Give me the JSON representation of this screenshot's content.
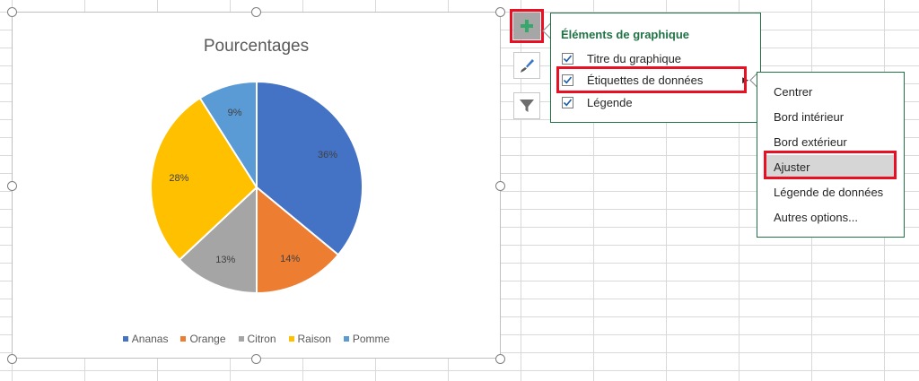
{
  "chart": {
    "title": "Pourcentages",
    "legend": [
      "Ananas",
      "Orange",
      "Citron",
      "Raison",
      "Pomme"
    ]
  },
  "chart_data": {
    "type": "pie",
    "title": "Pourcentages",
    "categories": [
      "Ananas",
      "Orange",
      "Citron",
      "Raison",
      "Pomme"
    ],
    "values": [
      36,
      14,
      13,
      28,
      9
    ],
    "labels": [
      "36%",
      "14%",
      "13%",
      "28%",
      "9%"
    ],
    "colors": [
      "#4472c4",
      "#ed7d31",
      "#a5a5a5",
      "#ffc000",
      "#5b9bd5"
    ],
    "legend_position": "bottom"
  },
  "side_buttons": {
    "add_icon": "plus-icon",
    "style_icon": "paintbrush-icon",
    "filter_icon": "funnel-icon"
  },
  "elements_panel": {
    "title": "Éléments de graphique",
    "items": [
      {
        "label": "Titre du graphique",
        "checked": true
      },
      {
        "label": "Étiquettes de données",
        "checked": true
      },
      {
        "label": "Légende",
        "checked": true
      }
    ]
  },
  "labels_submenu": {
    "items": [
      "Centrer",
      "Bord intérieur",
      "Bord extérieur",
      "Ajuster",
      "Légende de données",
      "Autres options..."
    ],
    "selected": "Ajuster"
  },
  "colors": {
    "accent": "#217346",
    "highlight": "#e81123"
  }
}
